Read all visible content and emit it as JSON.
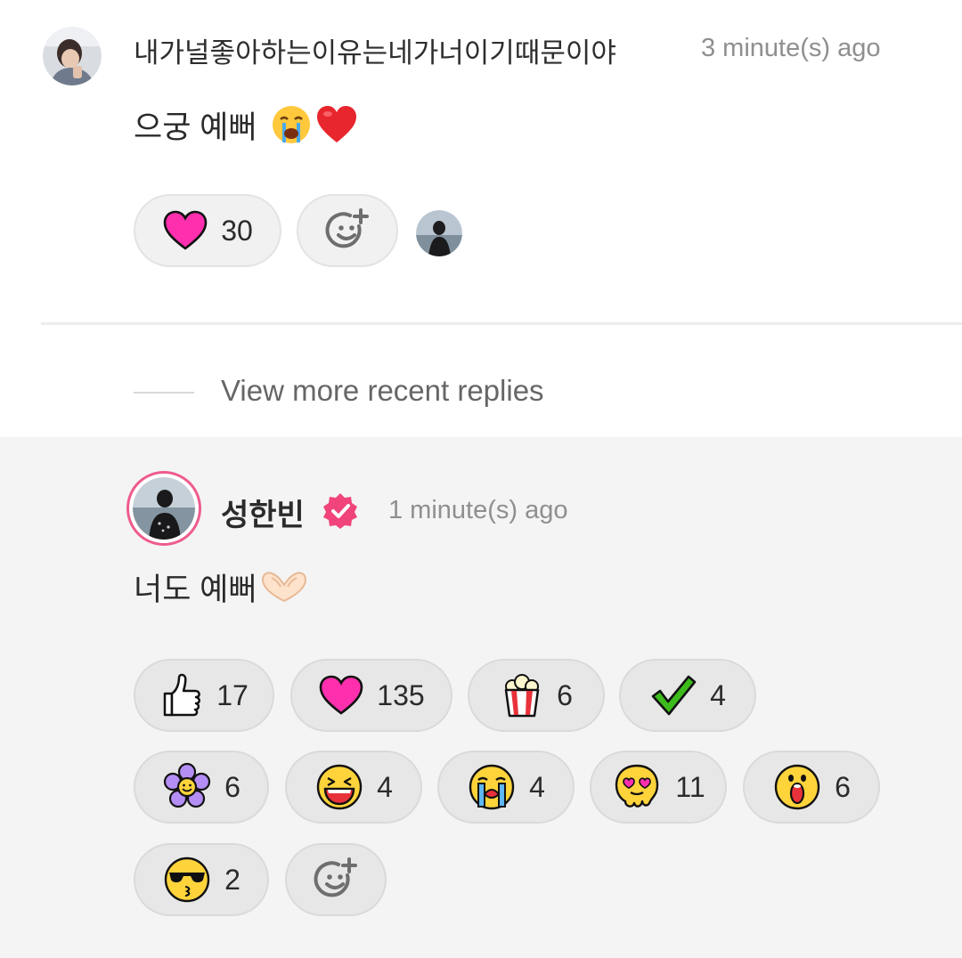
{
  "comment": {
    "username": "내가널좋아하는이유는네가너이기때문이야",
    "time": "3 minute(s) ago",
    "text": "으궁 예뻐",
    "reactions": [
      {
        "icon": "pink-heart-icon",
        "count": "30"
      }
    ],
    "add_reaction_icon": "add-reaction-icon"
  },
  "view_more": "View more recent replies",
  "reply": {
    "username": "성한빈",
    "verified_icon": "verified-badge-icon",
    "time": "1 minute(s) ago",
    "text": "너도 예뻐",
    "reactions": [
      {
        "icon": "thumbs-up-icon",
        "count": "17"
      },
      {
        "icon": "pink-heart-icon",
        "count": "135"
      },
      {
        "icon": "popcorn-icon",
        "count": "6"
      },
      {
        "icon": "checkmark-icon",
        "count": "4"
      },
      {
        "icon": "flower-icon",
        "count": "6"
      },
      {
        "icon": "laughing-face-icon",
        "count": "4"
      },
      {
        "icon": "crying-face-icon",
        "count": "4"
      },
      {
        "icon": "melting-heart-eyes-icon",
        "count": "11"
      },
      {
        "icon": "surprised-face-icon",
        "count": "6"
      },
      {
        "icon": "cool-kiss-face-icon",
        "count": "2"
      }
    ]
  },
  "colors": {
    "heart": "#ff2fae",
    "verified": "#f0447b",
    "check": "#3dbb1d",
    "reply_bg": "#f4f4f4",
    "avatar_ring": "#ee5b8d"
  }
}
